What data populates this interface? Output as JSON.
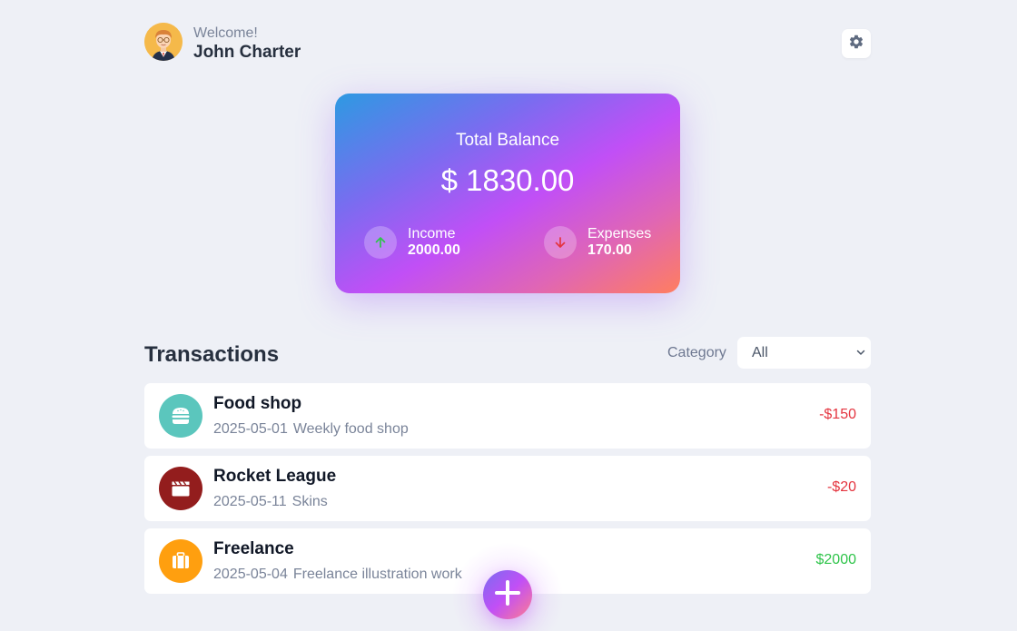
{
  "header": {
    "welcome": "Welcome!",
    "username": "John Charter"
  },
  "balance": {
    "label": "Total Balance",
    "amount": "$ 1830.00",
    "income_label": "Income",
    "income_value": "2000.00",
    "expenses_label": "Expenses",
    "expenses_value": "170.00"
  },
  "transactions": {
    "title": "Transactions",
    "category_label": "Category",
    "category_selected": "All",
    "items": [
      {
        "name": "Food shop",
        "date": "2025-05-01",
        "description": "Weekly food shop",
        "amount": "-$150",
        "icon": "burger-icon",
        "icon_color": "#5bc6bd"
      },
      {
        "name": "Rocket League",
        "date": "2025-05-11",
        "description": "Skins",
        "amount": "-$20",
        "icon": "clapperboard-icon",
        "icon_color": "#931d1d"
      },
      {
        "name": "Freelance",
        "date": "2025-05-04",
        "description": "Freelance illustration work",
        "amount": "$2000",
        "icon": "briefcase-icon",
        "icon_color": "#ff9f0f"
      }
    ]
  },
  "colors": {
    "negative": "#e4343f",
    "positive": "#2fc44a",
    "background": "#eef0f6"
  }
}
